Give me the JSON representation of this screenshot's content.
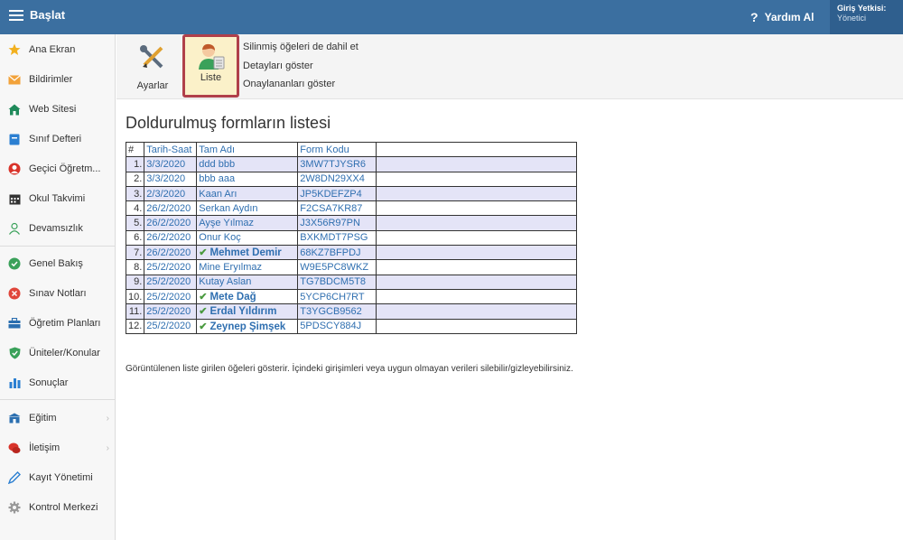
{
  "topbar": {
    "title": "Başlat",
    "help_label": "Yardım Al",
    "auth_label": "Giriş Yetkisi:",
    "auth_value": "Yönetici"
  },
  "sidebar": {
    "items": [
      {
        "label": "Ana Ekran",
        "icon": "star-icon",
        "color": "#f2b01e"
      },
      {
        "label": "Bildirimler",
        "icon": "envelope-icon",
        "color": "#f2a23a"
      },
      {
        "label": "Web Sitesi",
        "icon": "home-icon",
        "color": "#1f8a5a"
      },
      {
        "label": "Sınıf Defteri",
        "icon": "notebook-icon",
        "color": "#2b7fd1"
      },
      {
        "label": "Geçici Öğretm...",
        "icon": "person-icon",
        "color": "#d9332a"
      },
      {
        "label": "Okul Takvimi",
        "icon": "calendar-icon",
        "color": "#333333"
      },
      {
        "label": "Devamsızlık",
        "icon": "user-outline-icon",
        "color": "#3aa15a"
      },
      {
        "label": "Genel Bakış",
        "icon": "check-circle-icon",
        "color": "#3aa15a"
      },
      {
        "label": "Sınav Notları",
        "icon": "x-circle-icon",
        "color": "#e0463b"
      },
      {
        "label": "Öğretim Planları",
        "icon": "briefcase-icon",
        "color": "#2b6fb0"
      },
      {
        "label": "Üniteler/Konular",
        "icon": "shield-icon",
        "color": "#3aa15a"
      },
      {
        "label": "Sonuçlar",
        "icon": "bar-chart-icon",
        "color": "#2b7fd1"
      },
      {
        "label": "Eğitim",
        "icon": "school-icon",
        "color": "#2b6fb0"
      },
      {
        "label": "İletişim",
        "icon": "chat-icon",
        "color": "#d9332a"
      },
      {
        "label": "Kayıt Yönetimi",
        "icon": "pen-icon",
        "color": "#2b7fd1"
      },
      {
        "label": "Kontrol Merkezi",
        "icon": "gear-icon",
        "color": "#888888"
      }
    ]
  },
  "toolbar": {
    "settings_label": "Ayarlar",
    "list_label": "Liste",
    "options": [
      "Silinmiş öğeleri de dahil et",
      "Detayları göster",
      "Onaylananları göster"
    ]
  },
  "main": {
    "title": "Doldurulmuş formların listesi",
    "columns": [
      "#",
      "Tarih-Saat",
      "Tam Adı",
      "Form Kodu"
    ],
    "rows": [
      {
        "n": "1.",
        "date": "3/3/2020",
        "name": "ddd bbb",
        "code": "3MW7TJYSR6",
        "approved": false
      },
      {
        "n": "2.",
        "date": "3/3/2020",
        "name": "bbb aaa",
        "code": "2W8DN29XX4",
        "approved": false
      },
      {
        "n": "3.",
        "date": "2/3/2020",
        "name": "Kaan Arı",
        "code": "JP5KDEFZP4",
        "approved": false
      },
      {
        "n": "4.",
        "date": "26/2/2020",
        "name": "Serkan Aydın",
        "code": "F2CSA7KR87",
        "approved": false
      },
      {
        "n": "5.",
        "date": "26/2/2020",
        "name": "Ayşe Yılmaz",
        "code": "J3X56R97PN",
        "approved": false
      },
      {
        "n": "6.",
        "date": "26/2/2020",
        "name": "Onur Koç",
        "code": "BXKMDT7PSG",
        "approved": false
      },
      {
        "n": "7.",
        "date": "26/2/2020",
        "name": "Mehmet Demir",
        "code": "68KZ7BFPDJ",
        "approved": true
      },
      {
        "n": "8.",
        "date": "25/2/2020",
        "name": "Mine Eryılmaz",
        "code": "W9E5PC8WKZ",
        "approved": false
      },
      {
        "n": "9.",
        "date": "25/2/2020",
        "name": "Kutay Aslan",
        "code": "TG7BDCM5T8",
        "approved": false
      },
      {
        "n": "10.",
        "date": "25/2/2020",
        "name": "Mete Dağ",
        "code": "5YCP6CH7RT",
        "approved": true
      },
      {
        "n": "11.",
        "date": "25/2/2020",
        "name": "Erdal Yıldırım",
        "code": "T3YGCB9562",
        "approved": true
      },
      {
        "n": "12.",
        "date": "25/2/2020",
        "name": "Zeynep Şimşek",
        "code": "5PDSCY884J",
        "approved": true
      }
    ],
    "info": "Görüntülenen liste girilen öğeleri gösterir. İçindeki girişimleri veya uygun olmayan verileri silebilir/gizleyebilirsiniz."
  },
  "colors": {
    "topbar": "#3b6fa0",
    "auth_box": "#2f5f8e",
    "link": "#2f6fb0",
    "row_alt": "#e4e4f7",
    "selected_border": "#b0404a",
    "selected_bg": "#fbf1c9",
    "check": "#4a9a3f"
  }
}
